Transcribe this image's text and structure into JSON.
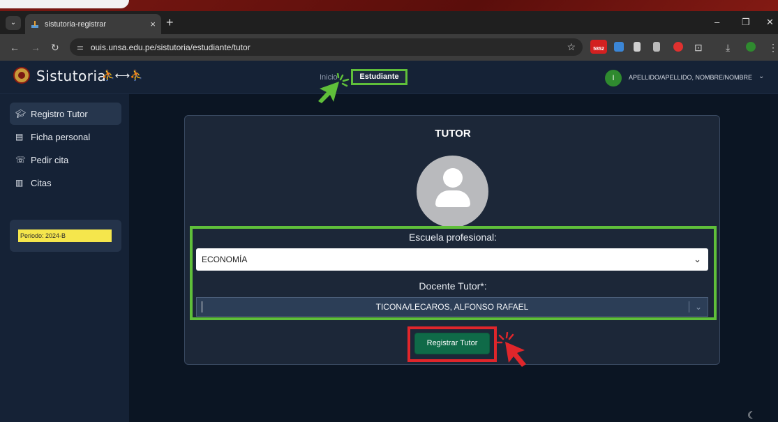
{
  "browser": {
    "tab_title": "sistutoria-registrar",
    "tab_close": "×",
    "new_tab": "+",
    "url": "ouis.unsa.edu.pe/sistutoria/estudiante/tutor",
    "extension_badge": "5852",
    "window_controls": [
      "–",
      "❐",
      "✕"
    ]
  },
  "header": {
    "brand": "Sistutoria",
    "nav_inicio": "Inicio",
    "nav_estudiante": "Estudiante",
    "user_initial": "I",
    "user_name": "APELLIDO/APELLIDO, NOMBRE/NOMBRE"
  },
  "sidebar": {
    "items": [
      {
        "label": "Registro Tutor",
        "icon": "graduation-cap-icon"
      },
      {
        "label": "Ficha personal",
        "icon": "id-card-icon"
      },
      {
        "label": "Pedir cita",
        "icon": "phone-icon"
      },
      {
        "label": "Citas",
        "icon": "book-open-icon"
      }
    ],
    "period": "Periodo: 2024-B"
  },
  "card": {
    "title": "TUTOR",
    "escuela_label": "Escuela profesional:",
    "escuela_value": "ECONOMÍA",
    "docente_label": "Docente Tutor*:",
    "docente_value": "TICONA/LECAROS, ALFONSO RAFAEL",
    "register_button": "Registrar Tutor"
  },
  "colors": {
    "highlight_green": "#5fbf3a",
    "highlight_red": "#e0262b",
    "button_green": "#0f6a48",
    "period_yellow": "#f5e64c"
  }
}
